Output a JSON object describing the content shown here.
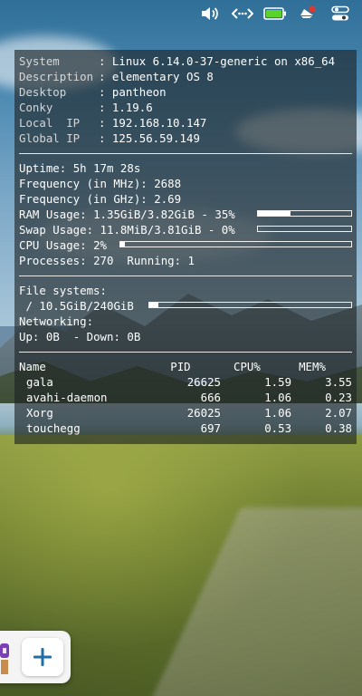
{
  "topbar": {
    "icons": [
      "volume-icon",
      "network-icon",
      "battery-icon",
      "notifications-icon",
      "session-toggle-icon"
    ],
    "battery_color": "#5bd22a",
    "notification_badge_color": "#e0362c"
  },
  "conky": {
    "system": [
      {
        "key": "System",
        "value": "Linux 6.14.0-37-generic on x86_64"
      },
      {
        "key": "Description",
        "value": "elementary OS 8"
      },
      {
        "key": "Desktop",
        "value": "pantheon"
      },
      {
        "key": "Conky",
        "value": "1.19.6"
      },
      {
        "key": "Local  IP",
        "value": "192.168.10.147"
      },
      {
        "key": "Global IP",
        "value": "125.56.59.149"
      }
    ],
    "uptime_label": "Uptime:",
    "uptime": "5h 17m 28s",
    "freq_mhz_label": "Frequency (in MHz):",
    "freq_mhz": "2688",
    "freq_ghz_label": "Frequency (in GHz):",
    "freq_ghz": "2.69",
    "ram_label": "RAM Usage:",
    "ram_value": "1.35GiB/3.82GiB - 35%",
    "ram_fraction": 0.35,
    "swap_label": "Swap Usage:",
    "swap_value": "11.8MiB/3.81GiB - 0%",
    "swap_fraction": 0.0,
    "cpu_label": "CPU Usage:",
    "cpu_value": "2%",
    "cpu_fraction": 0.02,
    "processes_label": "Processes:",
    "processes": "270",
    "running_label": "Running:",
    "running": "1",
    "fs_label": "File systems:",
    "fs_root": "/ 10.5GiB/240GiB",
    "fs_fraction": 0.044,
    "net_label": "Networking:",
    "net_up_label": "Up:",
    "net_up": "0B",
    "net_down_label": "- Down:",
    "net_down": "0B",
    "proc_headers": [
      "Name",
      "PID",
      "CPU%",
      "MEM%"
    ],
    "processes_list": [
      {
        "name": "gala",
        "pid": "26625",
        "cpu": "1.59",
        "mem": "3.55"
      },
      {
        "name": "avahi-daemon",
        "pid": "666",
        "cpu": "1.06",
        "mem": "0.23"
      },
      {
        "name": "Xorg",
        "pid": "26025",
        "cpu": "1.06",
        "mem": "2.07"
      },
      {
        "name": "touchegg",
        "pid": "697",
        "cpu": "0.53",
        "mem": "0.38"
      }
    ]
  },
  "dock": {
    "add_icon": "plus-icon",
    "add_color": "#1f6ea8"
  }
}
